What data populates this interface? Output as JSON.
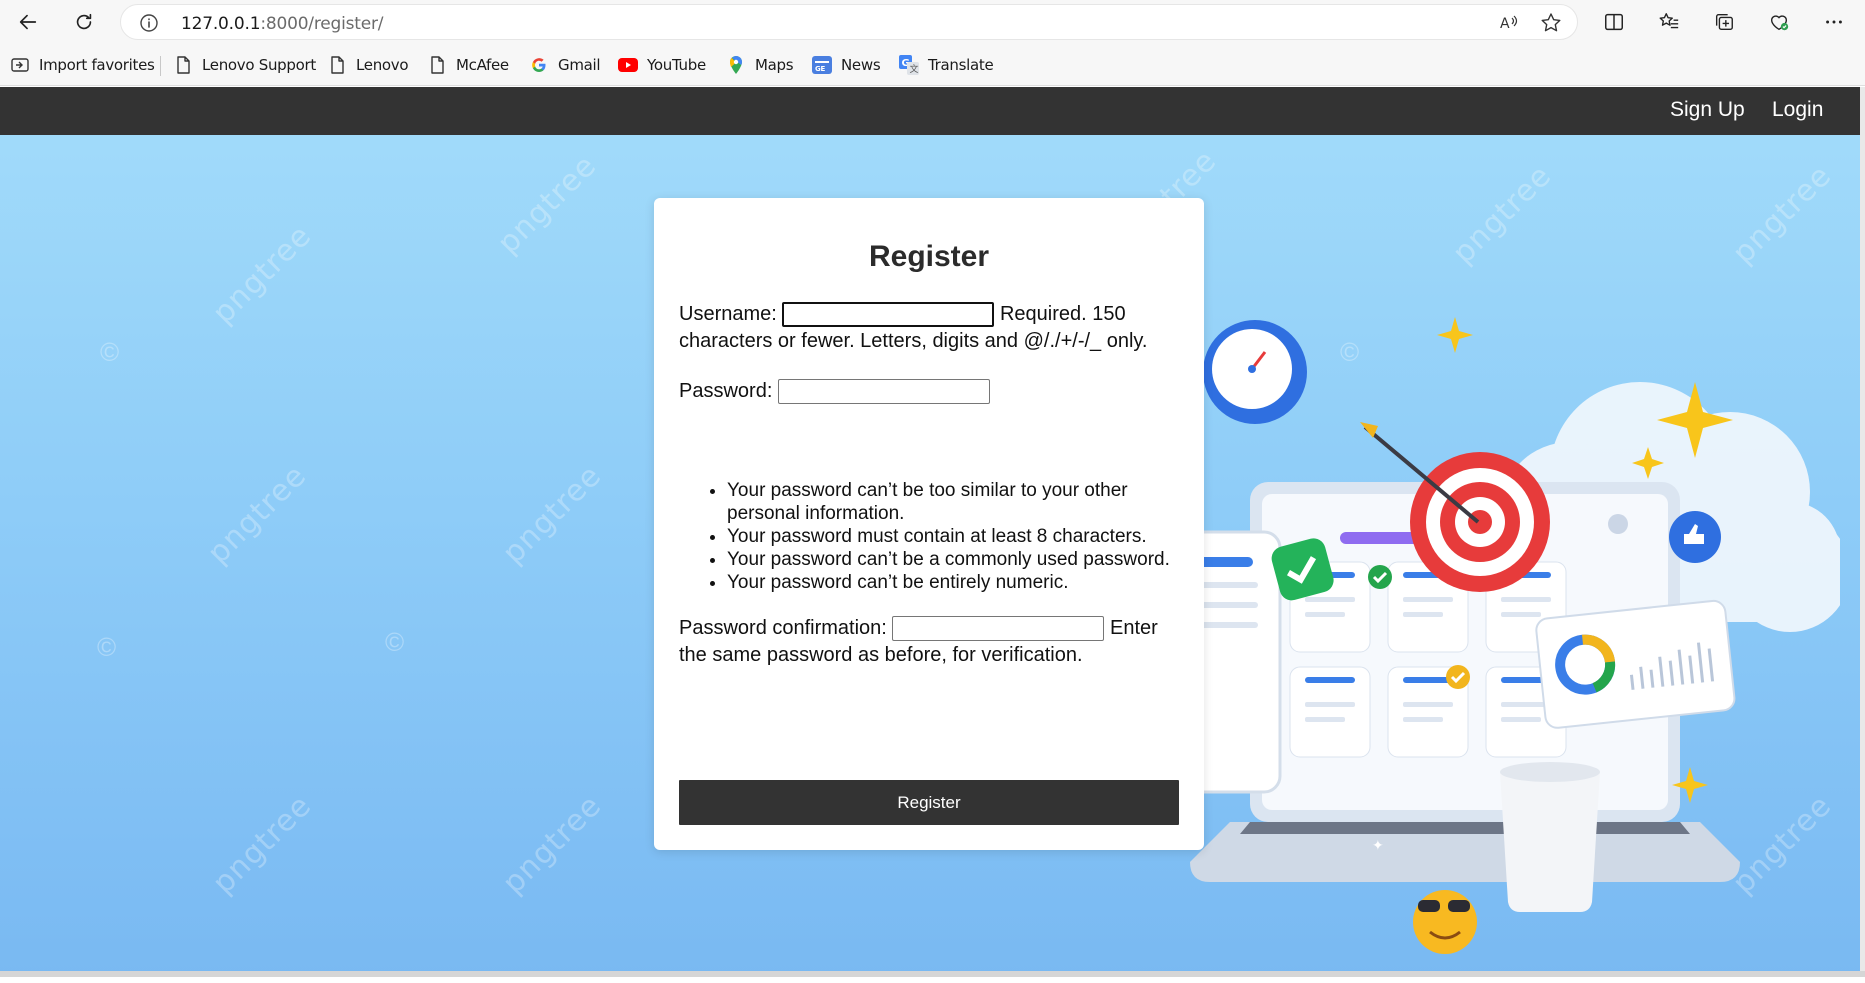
{
  "browser": {
    "url_host": "127.0.0.1",
    "url_rest": ":8000/register/",
    "bookmarks": [
      {
        "label": "Import favorites",
        "icon": "import-favorites-icon"
      },
      {
        "label": "Lenovo Support",
        "icon": "page-icon"
      },
      {
        "label": "Lenovo",
        "icon": "page-icon"
      },
      {
        "label": "McAfee",
        "icon": "page-icon"
      },
      {
        "label": "Gmail",
        "icon": "google-icon"
      },
      {
        "label": "YouTube",
        "icon": "youtube-icon"
      },
      {
        "label": "Maps",
        "icon": "maps-pin-icon"
      },
      {
        "label": "News",
        "icon": "news-icon"
      },
      {
        "label": "Translate",
        "icon": "translate-icon"
      }
    ]
  },
  "nav": {
    "signup": "Sign Up",
    "login": "Login"
  },
  "form": {
    "title": "Register",
    "username_label": "Username:",
    "username_help": "Required. 150 characters or fewer. Letters, digits and @/./+/-/_ only.",
    "password_label": "Password:",
    "password_hints": [
      "Your password can’t be too similar to your other personal information.",
      "Your password must contain at least 8 characters.",
      "Your password can’t be a commonly used password.",
      "Your password can’t be entirely numeric."
    ],
    "confirm_label": "Password confirmation:",
    "confirm_help": "Enter the same password as before, for verification.",
    "submit": "Register"
  },
  "watermark": "pngtree",
  "colors": {
    "navbar": "#333333",
    "button": "#333333",
    "background_top": "#a3dcfa",
    "background_bottom": "#79b9f2"
  }
}
